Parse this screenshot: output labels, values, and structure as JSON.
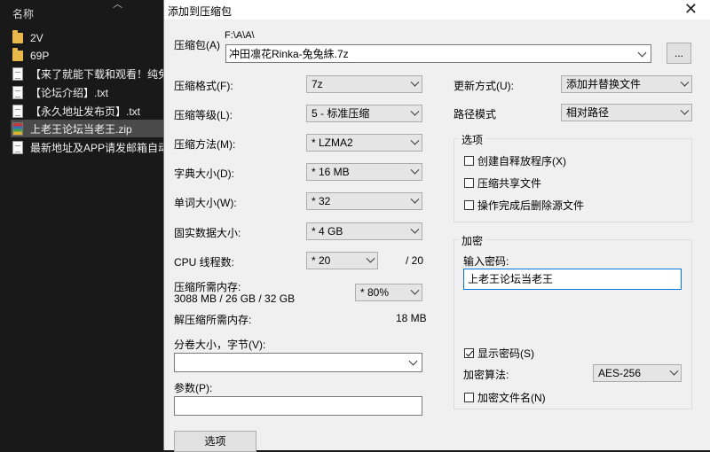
{
  "explorer": {
    "column_header": "名称",
    "files": [
      {
        "name": "2V",
        "icon": "folder-icon"
      },
      {
        "name": "69P",
        "icon": "folder-icon"
      },
      {
        "name": "【来了就能下载和观看！纯免",
        "icon": "text-file-icon"
      },
      {
        "name": "【论坛介绍】.txt",
        "icon": "text-file-icon"
      },
      {
        "name": "【永久地址发布页】.txt",
        "icon": "text-file-icon"
      },
      {
        "name": "上老王论坛当老王.zip",
        "icon": "zip-archive-icon",
        "selected": true
      },
      {
        "name": "最新地址及APP请发邮箱自动",
        "icon": "text-file-icon"
      }
    ]
  },
  "dialog": {
    "title": "添加到压缩包",
    "close_glyph": "✕",
    "archive_label": "压缩包(A)",
    "archive_path": "F:\\A\\A\\",
    "archive_name": "冲田凛花Rinka-兔兔絑.7z",
    "browse_label": "...",
    "format_label": "压缩格式(F):",
    "format_value": "7z",
    "level_label": "压缩等级(L):",
    "level_value": "5 - 标准压缩",
    "method_label": "压缩方法(M):",
    "method_value": "* LZMA2",
    "dict_label": "字典大小(D):",
    "dict_value": "* 16 MB",
    "word_label": "单词大小(W):",
    "word_value": "* 32",
    "solid_label": "固实数据大小:",
    "solid_value": "* 4 GB",
    "cpu_label": "CPU 线程数:",
    "cpu_value": "* 20",
    "cpu_total": "/ 20",
    "mem_comp_label": "压缩所需内存:",
    "mem_comp_value": "3088 MB / 26 GB / 32 GB",
    "mem_percent_value": "* 80%",
    "mem_decomp_label": "解压缩所需内存:",
    "mem_decomp_value": "18 MB",
    "split_label": "分卷大小，字节(V):",
    "split_value": "",
    "params_label": "参数(P):",
    "params_value": "",
    "options_button": "选项",
    "update_label": "更新方式(U):",
    "update_value": "添加并替换文件",
    "path_mode_label": "路径模式",
    "path_mode_value": "相对路径",
    "options_group_label": "选项",
    "opt_sfx": "创建自释放程序(X)",
    "opt_shared": "压缩共享文件",
    "opt_delete": "操作完成后删除源文件",
    "encrypt_group_label": "加密",
    "password_label": "输入密码:",
    "password_value": "上老王论坛当老王",
    "show_password": "显示密码(S)",
    "show_password_checked": true,
    "enc_method_label": "加密算法:",
    "enc_method_value": "AES-256",
    "encrypt_names": "加密文件名(N)"
  }
}
